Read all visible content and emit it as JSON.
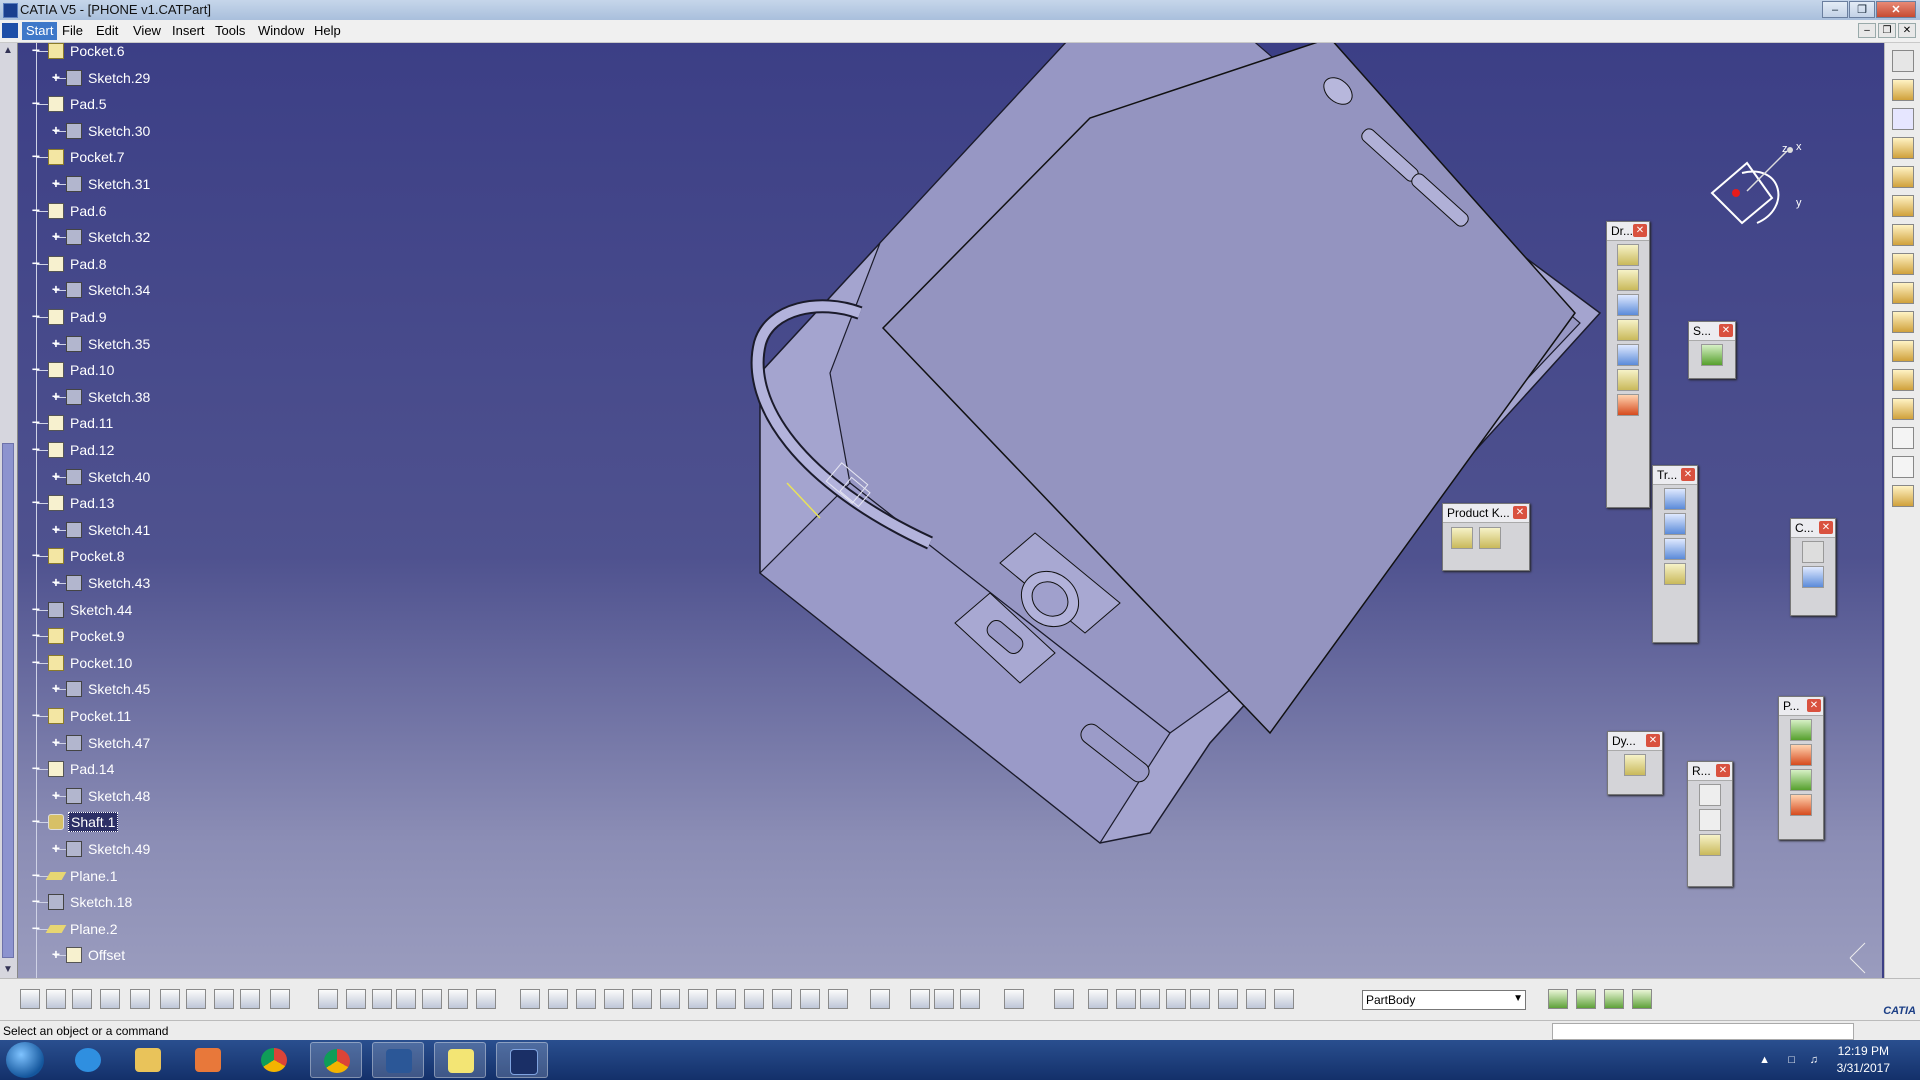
{
  "window": {
    "title": "CATIA V5 - [PHONE v1.CATPart]"
  },
  "menu": {
    "items": [
      "Start",
      "File",
      "Edit",
      "View",
      "Insert",
      "Tools",
      "Window",
      "Help"
    ]
  },
  "tree": {
    "nodes": [
      {
        "label": "Pocket.6",
        "kind": "pocket",
        "level": 0
      },
      {
        "label": "Sketch.29",
        "kind": "sketch",
        "level": 1
      },
      {
        "label": "Pad.5",
        "kind": "pad",
        "level": 0
      },
      {
        "label": "Sketch.30",
        "kind": "sketch",
        "level": 1
      },
      {
        "label": "Pocket.7",
        "kind": "pocket",
        "level": 0
      },
      {
        "label": "Sketch.31",
        "kind": "sketch",
        "level": 1
      },
      {
        "label": "Pad.6",
        "kind": "pad",
        "level": 0
      },
      {
        "label": "Sketch.32",
        "kind": "sketch",
        "level": 1
      },
      {
        "label": "Pad.8",
        "kind": "pad",
        "level": 0
      },
      {
        "label": "Sketch.34",
        "kind": "sketch",
        "level": 1
      },
      {
        "label": "Pad.9",
        "kind": "pad",
        "level": 0
      },
      {
        "label": "Sketch.35",
        "kind": "sketch",
        "level": 1
      },
      {
        "label": "Pad.10",
        "kind": "pad",
        "level": 0
      },
      {
        "label": "Sketch.38",
        "kind": "sketch",
        "level": 1
      },
      {
        "label": "Pad.11",
        "kind": "pad",
        "level": 0
      },
      {
        "label": "Pad.12",
        "kind": "pad",
        "level": 0
      },
      {
        "label": "Sketch.40",
        "kind": "sketch",
        "level": 1
      },
      {
        "label": "Pad.13",
        "kind": "pad",
        "level": 0
      },
      {
        "label": "Sketch.41",
        "kind": "sketch",
        "level": 1
      },
      {
        "label": "Pocket.8",
        "kind": "pocket",
        "level": 0
      },
      {
        "label": "Sketch.43",
        "kind": "sketch",
        "level": 1
      },
      {
        "label": "Sketch.44",
        "kind": "sketch",
        "level": 0
      },
      {
        "label": "Pocket.9",
        "kind": "pocket",
        "level": 0
      },
      {
        "label": "Pocket.10",
        "kind": "pocket",
        "level": 0
      },
      {
        "label": "Sketch.45",
        "kind": "sketch",
        "level": 1
      },
      {
        "label": "Pocket.11",
        "kind": "pocket",
        "level": 0
      },
      {
        "label": "Sketch.47",
        "kind": "sketch",
        "level": 1
      },
      {
        "label": "Pad.14",
        "kind": "pad",
        "level": 0
      },
      {
        "label": "Sketch.48",
        "kind": "sketch",
        "level": 1
      },
      {
        "label": "Shaft.1",
        "kind": "shaft",
        "level": 0,
        "selected": true
      },
      {
        "label": "Sketch.49",
        "kind": "sketch",
        "level": 1
      },
      {
        "label": "Plane.1",
        "kind": "plane",
        "level": 0
      },
      {
        "label": "Sketch.18",
        "kind": "sketch",
        "level": 0
      },
      {
        "label": "Plane.2",
        "kind": "plane",
        "level": 0
      },
      {
        "label": "Offset",
        "kind": "pad",
        "level": 1
      }
    ]
  },
  "toolbars": {
    "drafting": "Dr...",
    "surface": "S...",
    "transform": "Tr...",
    "product_knowledge": "Product K...",
    "constraints": "C...",
    "dynamic": "Dy...",
    "reference": "R...",
    "part_body": "P..."
  },
  "compass": {
    "x": "x",
    "y": "y",
    "z": "z"
  },
  "body_selector": {
    "value": "PartBody"
  },
  "status": {
    "message": "Select an object or a command"
  },
  "catia_logo": "CATIA",
  "clock": {
    "time": "12:19 PM",
    "date": "3/31/2017"
  },
  "colors": {
    "background_top": "#3c3f86",
    "background_bottom": "#9a9cbe",
    "part_fill": "#a6a6cf",
    "highlight": "#2c2f66"
  }
}
